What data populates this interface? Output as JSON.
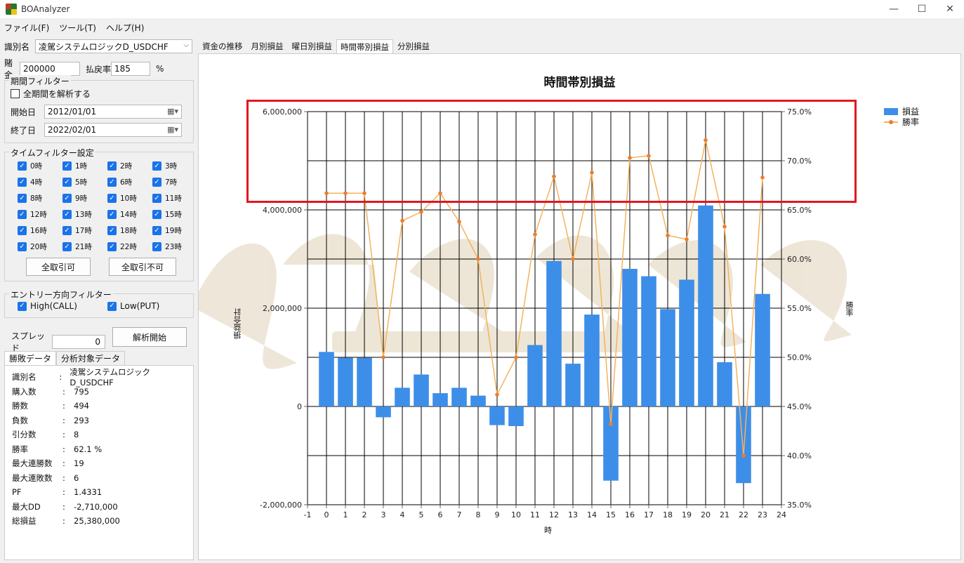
{
  "window": {
    "title": "BOAnalyzer",
    "minimize": "—",
    "maximize": "☐",
    "close": "✕"
  },
  "menu": [
    "ファイル(F)",
    "ツール(T)",
    "ヘルプ(H)"
  ],
  "settings": {
    "id_label": "識別名",
    "id_value": "凌駕システムロジックD_USDCHF",
    "bet_label": "賭金",
    "bet_value": "200000",
    "payout_label": "払戻率",
    "payout_value": "185",
    "payout_unit": "%"
  },
  "period_filter": {
    "title": "期間フィルター",
    "all_period_label": "全期間を解析する",
    "start_label": "開始日",
    "start_value": "2012/01/01",
    "end_label": "終了日",
    "end_value": "2022/02/01"
  },
  "time_filter": {
    "title": "タイムフィルター設定",
    "hours": [
      "0時",
      "1時",
      "2時",
      "3時",
      "4時",
      "5時",
      "6時",
      "7時",
      "8時",
      "9時",
      "10時",
      "11時",
      "12時",
      "13時",
      "14時",
      "15時",
      "16時",
      "17時",
      "18時",
      "19時",
      "20時",
      "21時",
      "22時",
      "23時"
    ],
    "all_on_label": "全取引可",
    "all_off_label": "全取引不可"
  },
  "direction_filter": {
    "title": "エントリー方向フィルター",
    "high_label": "High(CALL)",
    "low_label": "Low(PUT)"
  },
  "spread": {
    "label": "スプレッド",
    "value": "0",
    "analyze_button": "解析開始"
  },
  "result_tabs": [
    "勝敗データ",
    "分析対象データ"
  ],
  "stats": [
    {
      "k": "識別名",
      "v": "凌駕システムロジックD_USDCHF"
    },
    {
      "k": "購入数",
      "v": "795"
    },
    {
      "k": "勝数",
      "v": "494"
    },
    {
      "k": "負数",
      "v": "293"
    },
    {
      "k": "引分数",
      "v": "8"
    },
    {
      "k": "勝率",
      "v": "62.1 %"
    },
    {
      "k": "最大連勝数",
      "v": "19"
    },
    {
      "k": "最大連敗数",
      "v": "6"
    },
    {
      "k": "PF",
      "v": "1.4331"
    },
    {
      "k": "最大DD",
      "v": "-2,710,000"
    },
    {
      "k": "総損益",
      "v": "25,380,000"
    }
  ],
  "stat_colon": ":",
  "chart_tabs": [
    "資金の推移",
    "月別損益",
    "曜日別損益",
    "時間帯別損益",
    "分別損益"
  ],
  "colors": {
    "bar": "#3d8ee8",
    "line": "#f5b25c",
    "marker": "#ef7d2c",
    "highlight": "#e0181f",
    "accent": "#1a73e8"
  },
  "chart_data": {
    "type": "bar",
    "title": "時間帯別損益",
    "xlabel": "時",
    "ylabel": "損益合計",
    "y2label": "勝率",
    "x": [
      0,
      1,
      2,
      3,
      4,
      5,
      6,
      7,
      8,
      9,
      10,
      11,
      12,
      13,
      14,
      15,
      16,
      17,
      18,
      19,
      20,
      21,
      22,
      23
    ],
    "xlim": [
      -1,
      24
    ],
    "xticks": [
      -1,
      0,
      1,
      2,
      3,
      4,
      5,
      6,
      7,
      8,
      9,
      10,
      11,
      12,
      13,
      14,
      15,
      16,
      17,
      18,
      19,
      20,
      21,
      22,
      23,
      24
    ],
    "ylim": [
      -2000000,
      6000000
    ],
    "yticks": [
      -2000000,
      0,
      2000000,
      4000000,
      6000000
    ],
    "ytick_labels": [
      "-2,000,000",
      "0",
      "2,000,000",
      "4,000,000",
      "6,000,000"
    ],
    "y2lim": [
      35,
      75
    ],
    "y2ticks": [
      35,
      40,
      45,
      50,
      55,
      60,
      65,
      70,
      75
    ],
    "y2tick_labels": [
      "35.0%",
      "40.0%",
      "45.0%",
      "50.0%",
      "55.0%",
      "60.0%",
      "65.0%",
      "70.0%",
      "75.0%"
    ],
    "grid": true,
    "legend_position": "top-right",
    "series": [
      {
        "name": "損益",
        "kind": "bar",
        "axis": "left",
        "values": [
          1110000,
          990000,
          990000,
          -220000,
          380000,
          650000,
          270000,
          380000,
          220000,
          -380000,
          -400000,
          1250000,
          2960000,
          870000,
          1870000,
          -1510000,
          2800000,
          2650000,
          1980000,
          2580000,
          4090000,
          900000,
          -1560000,
          2290000
        ]
      },
      {
        "name": "勝率",
        "kind": "line",
        "axis": "right",
        "values": [
          66.7,
          66.7,
          66.7,
          50.0,
          63.9,
          64.8,
          66.7,
          63.8,
          60.0,
          46.2,
          50.0,
          62.5,
          68.4,
          60.0,
          68.8,
          43.2,
          70.3,
          70.5,
          62.4,
          62.0,
          72.1,
          63.3,
          40.0,
          68.3
        ]
      }
    ]
  }
}
